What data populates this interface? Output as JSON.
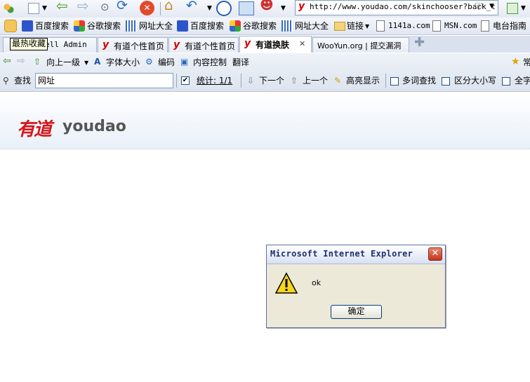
{
  "toolbar": {
    "address_url": "http://www.youdao.com/skinchooser?back_t"
  },
  "bookmarks": {
    "items": [
      {
        "label": "百度搜索"
      },
      {
        "label": "谷歌搜索"
      },
      {
        "label": "网址大全"
      },
      {
        "label": "百度搜索"
      },
      {
        "label": "谷歌搜索"
      },
      {
        "label": "网址大全"
      },
      {
        "label": "链接"
      },
      {
        "label": "1141a.com"
      },
      {
        "label": "MSN.com"
      },
      {
        "label": "电台指南"
      }
    ]
  },
  "tooltip": "最热收藏",
  "tabs": [
    {
      "label": "WebShell Admin"
    },
    {
      "label": "有道个性首页"
    },
    {
      "label": "有道个性首页"
    },
    {
      "label": "有道换肤"
    },
    {
      "label": "WooYun.org | 提交漏洞"
    }
  ],
  "findbar": {
    "up_label": "向上一级",
    "font_label": "字体大小",
    "encoding_label": "编码",
    "content_label": "内容控制",
    "translate_label": "翻译",
    "favorites_label": "常",
    "find_label": "查找",
    "find_value": "网址",
    "stats_label": "统计: 1/1",
    "next_label": "下一个",
    "prev_label": "上一个",
    "highlight_label": "高亮显示",
    "multi_label": "多词查找",
    "case_label": "区分大小写",
    "whole_label": "全字"
  },
  "page": {
    "logo_cn": "有道",
    "logo_en": "youdao"
  },
  "dialog": {
    "title": "Microsoft Internet Explorer",
    "message": "ok",
    "ok_label": "确定",
    "close_glyph": "✕"
  },
  "colors": {
    "brand_red": "#d4161a",
    "dialog_bg": "#ece9d8",
    "close_red": "#c2341c"
  }
}
